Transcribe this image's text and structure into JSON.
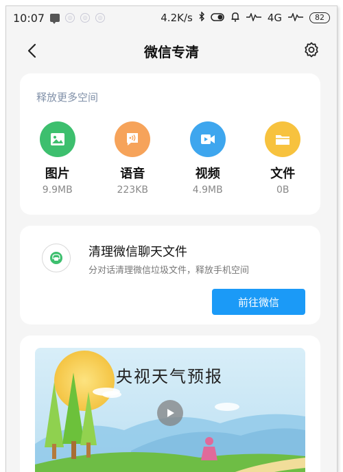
{
  "status_bar": {
    "time": "10:07",
    "speed": "4.2K/s",
    "network": "4G",
    "battery": "82"
  },
  "nav": {
    "title": "微信专清"
  },
  "space_card": {
    "title": "释放更多空间",
    "categories": [
      {
        "label": "图片",
        "size": "9.9MB",
        "color": "#3dbf6e",
        "icon": "image-icon"
      },
      {
        "label": "语音",
        "size": "223KB",
        "color": "#f6a35a",
        "icon": "voice-icon"
      },
      {
        "label": "视频",
        "size": "4.9MB",
        "color": "#3ea6ee",
        "icon": "video-icon"
      },
      {
        "label": "文件",
        "size": "0B",
        "color": "#f7c23e",
        "icon": "folder-icon"
      }
    ]
  },
  "clean_card": {
    "title": "清理微信聊天文件",
    "description": "分对话清理微信垃圾文件，释放手机空间",
    "button_label": "前往微信"
  },
  "weather_card": {
    "title": "央视天气预报"
  },
  "colors": {
    "accent": "#1b9af7",
    "background": "#f5f5f5"
  }
}
